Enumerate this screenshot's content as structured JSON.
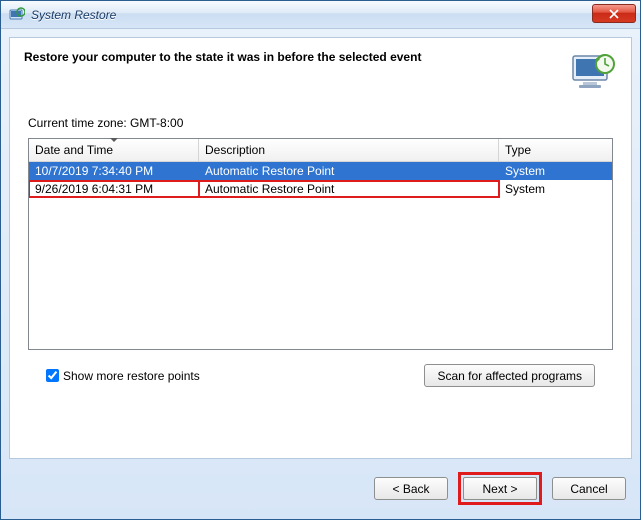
{
  "window": {
    "title": "System Restore",
    "close_label": "Close"
  },
  "header": {
    "heading": "Restore your computer to the state it was in before the selected event"
  },
  "body": {
    "timezone_label": "Current time zone: GMT-8:00",
    "columns": {
      "datetime": "Date and Time",
      "description": "Description",
      "type": "Type"
    },
    "rows": [
      {
        "datetime": "10/7/2019 7:34:40 PM",
        "description": "Automatic Restore Point",
        "type": "System",
        "selected": true,
        "highlighted": false
      },
      {
        "datetime": "9/26/2019 6:04:31 PM",
        "description": "Automatic Restore Point",
        "type": "System",
        "selected": false,
        "highlighted": true
      }
    ],
    "show_more_label": "Show more restore points",
    "show_more_checked": true,
    "scan_btn_label": "Scan for affected programs"
  },
  "wizard": {
    "back": "< Back",
    "next": "Next >",
    "cancel": "Cancel"
  }
}
